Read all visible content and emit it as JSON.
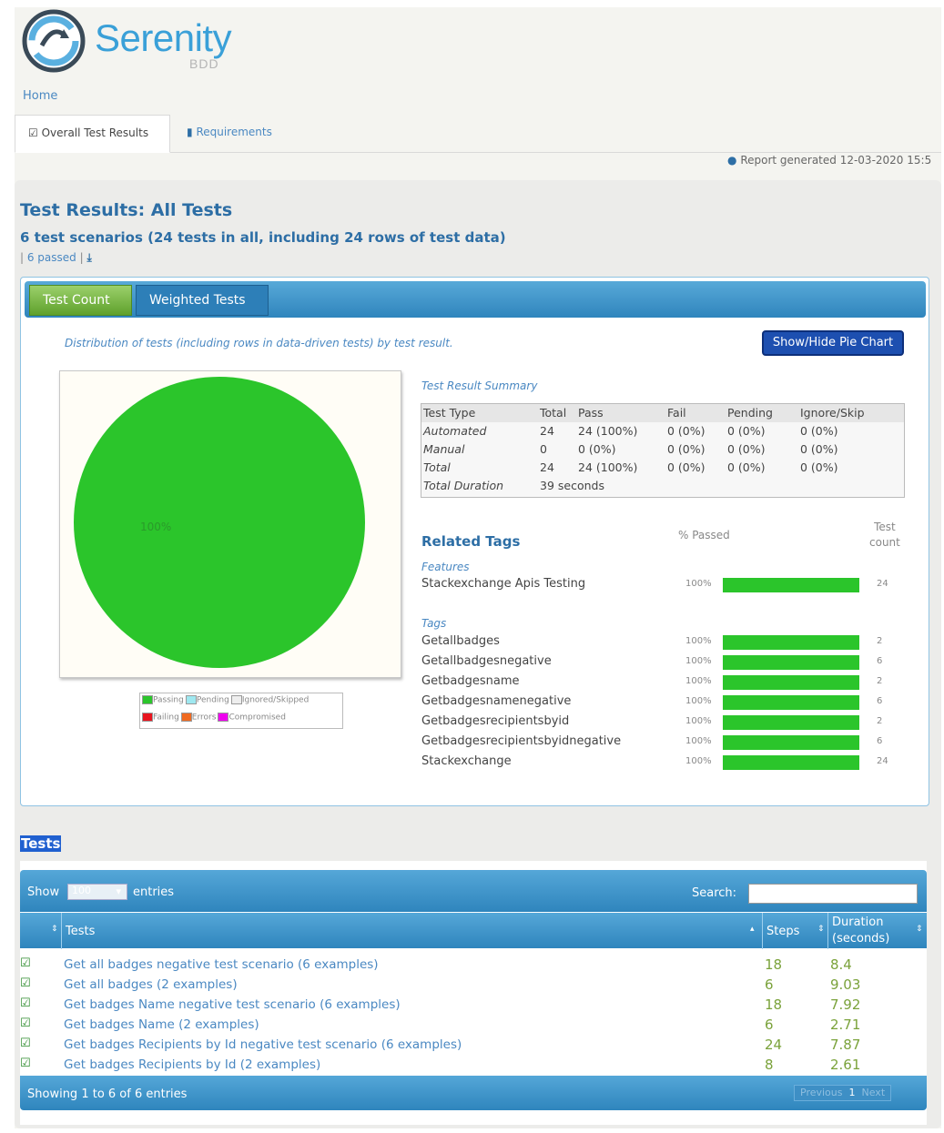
{
  "header": {
    "logo_text": "Serenity",
    "logo_sub": "BDD",
    "home_link": "Home"
  },
  "tabs": [
    {
      "label": "Overall Test Results",
      "icon": "checkbox-icon",
      "active": true
    },
    {
      "label": "Requirements",
      "icon": "book-icon",
      "active": false
    }
  ],
  "report_generated": "Report generated 12-03-2020 15:5",
  "results": {
    "title": "Test Results: All Tests",
    "subtitle": "6 test scenarios (24 tests in all, including 24 rows of test data)",
    "passed_link": "6 passed"
  },
  "chart_panel": {
    "tab_count": "Test Count",
    "tab_weighted": "Weighted Tests",
    "distribution_text": "Distribution of tests (including rows in data-driven tests) by test result.",
    "show_hide_button": "Show/Hide Pie Chart",
    "pie_label": "100%"
  },
  "chart_data": {
    "type": "pie",
    "categories": [
      "Passing",
      "Pending",
      "Ignored/Skipped",
      "Failing",
      "Errors",
      "Compromised"
    ],
    "values": [
      100,
      0,
      0,
      0,
      0,
      0
    ],
    "colors": [
      "#2bc52b",
      "#9fe8f0",
      "#eeeeee",
      "#e8141e",
      "#f06a20",
      "#ee00ee"
    ],
    "data_label": "100%"
  },
  "legend": [
    {
      "label": "Passing",
      "color": "#2bc52b"
    },
    {
      "label": "Pending",
      "color": "#9fe8f0"
    },
    {
      "label": "Ignored/Skipped",
      "color": "#eeeeee"
    },
    {
      "label": "Failing",
      "color": "#e8141e"
    },
    {
      "label": "Errors",
      "color": "#f06a20"
    },
    {
      "label": "Compromised",
      "color": "#ee00ee"
    }
  ],
  "summary": {
    "title": "Test Result Summary",
    "headers": [
      "Test Type",
      "Total",
      "Pass",
      "Fail",
      "Pending",
      "Ignore/Skip"
    ],
    "rows": [
      [
        "Automated",
        "24",
        "24 (100%)",
        "0 (0%)",
        "0 (0%)",
        "0 (0%)"
      ],
      [
        "Manual",
        "0",
        "0 (0%)",
        "0 (0%)",
        "0 (0%)",
        "0 (0%)"
      ],
      [
        "Total",
        "24",
        "24 (100%)",
        "0 (0%)",
        "0 (0%)",
        "0 (0%)"
      ]
    ],
    "duration_label": "Total Duration",
    "duration_value": "39 seconds"
  },
  "related_tags": {
    "title": "Related Tags",
    "pct_header": "% Passed",
    "count_header_1": "Test",
    "count_header_2": "count",
    "features_label": "Features",
    "features": [
      {
        "name": "Stackexchange Apis Testing",
        "pct": "100%",
        "pct_value": 100,
        "count": "24"
      }
    ],
    "tags_label": "Tags",
    "tags": [
      {
        "name": "Getallbadges",
        "pct": "100%",
        "pct_value": 100,
        "count": "2"
      },
      {
        "name": "Getallbadgesnegative",
        "pct": "100%",
        "pct_value": 100,
        "count": "6"
      },
      {
        "name": "Getbadgesname",
        "pct": "100%",
        "pct_value": 100,
        "count": "2"
      },
      {
        "name": "Getbadgesnamenegative",
        "pct": "100%",
        "pct_value": 100,
        "count": "6"
      },
      {
        "name": "Getbadgesrecipientsbyid",
        "pct": "100%",
        "pct_value": 100,
        "count": "2"
      },
      {
        "name": "Getbadgesrecipientsbyidnegative",
        "pct": "100%",
        "pct_value": 100,
        "count": "6"
      },
      {
        "name": "Stackexchange",
        "pct": "100%",
        "pct_value": 100,
        "count": "24"
      }
    ]
  },
  "tests": {
    "heading": "Tests",
    "show_label": "Show",
    "show_value": "100",
    "entries_label": "entries",
    "search_label": "Search:",
    "search_value": "",
    "col_tests": "Tests",
    "col_steps": "Steps",
    "col_duration_1": "Duration",
    "col_duration_2": "(seconds)",
    "rows": [
      {
        "name": "Get all badges negative test scenario (6 examples)",
        "steps": "18",
        "duration": "8.4"
      },
      {
        "name": "Get all badges (2 examples)",
        "steps": "6",
        "duration": "9.03"
      },
      {
        "name": "Get badges Name negative test scenario (6 examples)",
        "steps": "18",
        "duration": "7.92"
      },
      {
        "name": "Get badges Name (2 examples)",
        "steps": "6",
        "duration": "2.71"
      },
      {
        "name": "Get badges Recipients by Id negative test scenario (6 examples)",
        "steps": "24",
        "duration": "7.87"
      },
      {
        "name": "Get badges Recipients by Id (2 examples)",
        "steps": "8",
        "duration": "2.61"
      }
    ],
    "showing_text": "Showing 1 to 6 of 6 entries",
    "pager_prev": "Previous",
    "pager_page": "1",
    "pager_next": "Next"
  }
}
